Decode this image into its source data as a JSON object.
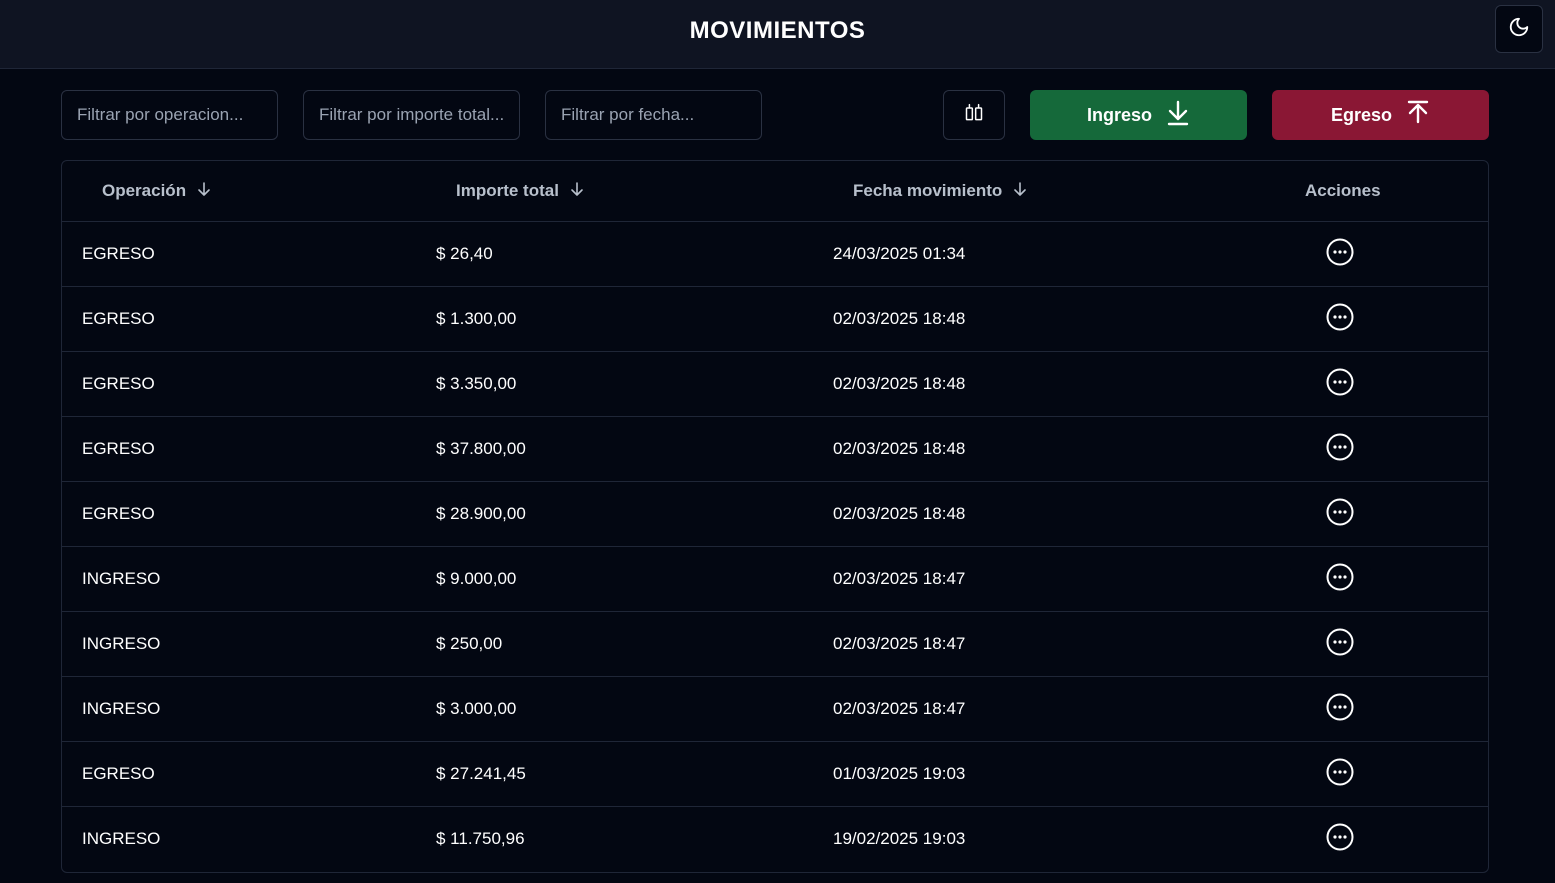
{
  "header": {
    "title": "MOVIMIENTOS",
    "theme_toggle_icon": "moon-icon"
  },
  "filters": {
    "operacion_placeholder": "Filtrar por operacion...",
    "importe_placeholder": "Filtrar por importe total...",
    "fecha_placeholder": "Filtrar por fecha..."
  },
  "toolbar": {
    "columns_icon": "columns-icon",
    "ingreso_label": "Ingreso",
    "ingreso_icon": "download-icon",
    "egreso_label": "Egreso",
    "egreso_icon": "upload-icon",
    "ingreso_color": "#15693a",
    "egreso_color": "#8a1734"
  },
  "table": {
    "columns": {
      "operacion": "Operación",
      "importe": "Importe total",
      "fecha": "Fecha movimiento",
      "acciones": "Acciones"
    },
    "rows": [
      {
        "operacion": "EGRESO",
        "importe": "$ 26,40",
        "fecha": "24/03/2025 01:34"
      },
      {
        "operacion": "EGRESO",
        "importe": "$ 1.300,00",
        "fecha": "02/03/2025 18:48"
      },
      {
        "operacion": "EGRESO",
        "importe": "$ 3.350,00",
        "fecha": "02/03/2025 18:48"
      },
      {
        "operacion": "EGRESO",
        "importe": "$ 37.800,00",
        "fecha": "02/03/2025 18:48"
      },
      {
        "operacion": "EGRESO",
        "importe": "$ 28.900,00",
        "fecha": "02/03/2025 18:48"
      },
      {
        "operacion": "INGRESO",
        "importe": "$ 9.000,00",
        "fecha": "02/03/2025 18:47"
      },
      {
        "operacion": "INGRESO",
        "importe": "$ 250,00",
        "fecha": "02/03/2025 18:47"
      },
      {
        "operacion": "INGRESO",
        "importe": "$ 3.000,00",
        "fecha": "02/03/2025 18:47"
      },
      {
        "operacion": "EGRESO",
        "importe": "$ 27.241,45",
        "fecha": "01/03/2025 19:03"
      },
      {
        "operacion": "INGRESO",
        "importe": "$ 11.750,96",
        "fecha": "19/02/2025 19:03"
      }
    ]
  }
}
